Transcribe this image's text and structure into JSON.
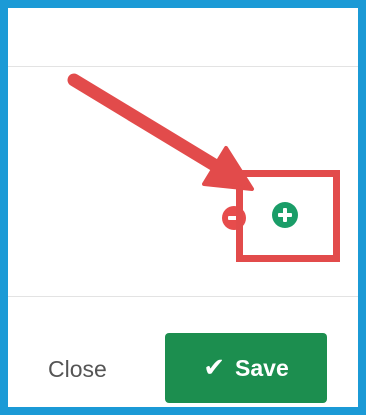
{
  "footer": {
    "close_label": "Close",
    "save_label": "Save",
    "save_icon": "✔"
  },
  "row_controls": {
    "remove_icon": "minus-circle-icon",
    "add_icon": "plus-circle-icon"
  },
  "annotation": {
    "arrow_color": "#e24b4b",
    "box_color": "#e24b4b"
  },
  "colors": {
    "frame_border": "#1b9ad6",
    "save_bg": "#1c8e4f",
    "add_green": "#1a9d68",
    "remove_red": "#e74c4c"
  }
}
